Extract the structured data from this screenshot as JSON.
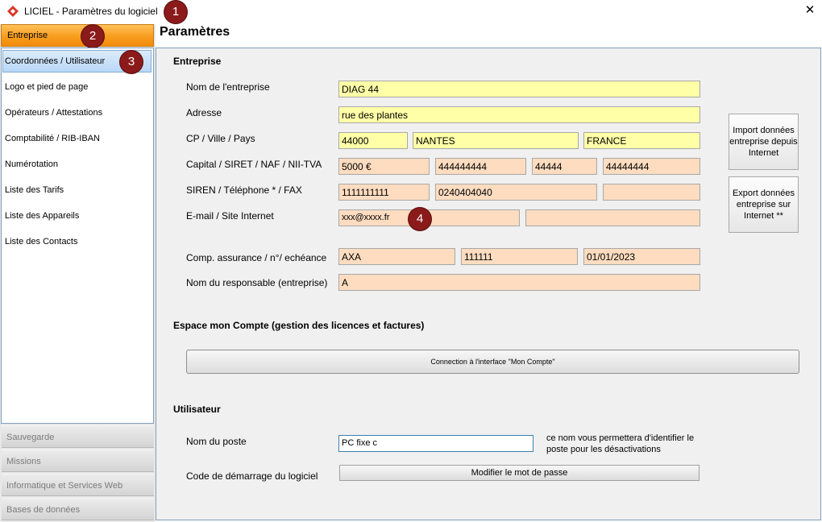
{
  "window": {
    "title": "LICIEL - Paramètres du logiciel",
    "close_label": "✕"
  },
  "badges": [
    "1",
    "2",
    "3",
    "4"
  ],
  "sidebar": {
    "active_section": "Entreprise",
    "items": [
      "Coordonnées / Utilisateur",
      "Logo et pied de page",
      "Opérateurs / Attestations",
      "Comptabilité / RIB-IBAN",
      "Numérotation",
      "Liste des Tarifs",
      "Liste des Appareils",
      "Liste des Contacts"
    ],
    "sections": [
      "Sauvegarde",
      "Missions",
      "Informatique et Services Web",
      "Bases de données"
    ]
  },
  "page_title": "Paramètres",
  "entreprise": {
    "section_title": "Entreprise",
    "labels": {
      "name": "Nom de l'entreprise",
      "address": "Adresse",
      "cp_city_country": "CP / Ville / Pays",
      "capital": "Capital / SIRET / NAF / NII-TVA",
      "siren": "SIREN / Téléphone * / FAX",
      "email": "E-mail / Site Internet",
      "insurance": "Comp. assurance / n°/ echéance",
      "manager": "Nom du responsable (entreprise)"
    },
    "values": {
      "name": "DIAG 44",
      "address": "rue des plantes",
      "cp": "44000",
      "city": "NANTES",
      "country": "FRANCE",
      "capital": "5000 €",
      "siret": "444444444",
      "naf": "44444",
      "tva": "44444444",
      "siren": "1111111111",
      "phone": "0240404040",
      "fax": "",
      "email": "xxx@xxxx.fr",
      "website": "",
      "insurer": "AXA",
      "policy_number": "111111",
      "expiry": "01/01/2023",
      "manager": "A"
    },
    "import_button": "Import données entreprise depuis Internet",
    "export_button": "Export données entreprise sur Internet **"
  },
  "account": {
    "section_title": "Espace mon Compte (gestion des licences et factures)",
    "connect_button": "Connection à l'interface \"Mon Compte\""
  },
  "user": {
    "section_title": "Utilisateur",
    "workstation_label": "Nom du poste",
    "workstation_value": "PC fixe c",
    "hint": "ce nom vous permettera d'identifier le poste pour les désactivations",
    "startup_label": "Code de démarrage du logiciel",
    "change_password_button": "Modifier le mot de passe"
  },
  "colors": {
    "required_field": "#ffffa8",
    "optional_field": "#fddcc0",
    "active_section": "#f79d1d",
    "badge": "#8b1a1a"
  }
}
